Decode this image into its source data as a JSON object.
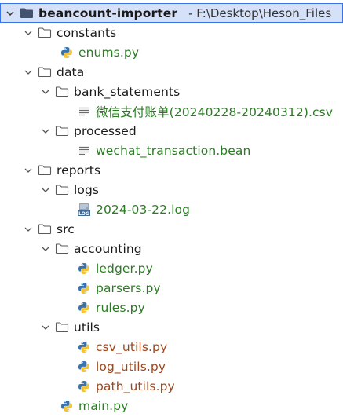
{
  "tree": {
    "root": {
      "name": "beancount-importer",
      "path": "- F:\\Desktop\\Heson_Files"
    },
    "items": [
      {
        "label": "constants"
      },
      {
        "label": "enums.py"
      },
      {
        "label": "data"
      },
      {
        "label": "bank_statements"
      },
      {
        "label": "微信支付账单(20240228-20240312).csv"
      },
      {
        "label": "processed"
      },
      {
        "label": "wechat_transaction.bean"
      },
      {
        "label": "reports"
      },
      {
        "label": "logs"
      },
      {
        "label": "2024-03-22.log"
      },
      {
        "label": "src"
      },
      {
        "label": "accounting"
      },
      {
        "label": "ledger.py"
      },
      {
        "label": "parsers.py"
      },
      {
        "label": "rules.py"
      },
      {
        "label": "utils"
      },
      {
        "label": "csv_utils.py"
      },
      {
        "label": "log_utils.py"
      },
      {
        "label": "path_utils.py"
      },
      {
        "label": "main.py"
      }
    ]
  },
  "colors": {
    "selection_bg": "#d5e1f8",
    "selection_border": "#3874e8",
    "file_green": "#2a7d22",
    "file_modified": "#a0461c",
    "text": "#1a1a1a"
  }
}
